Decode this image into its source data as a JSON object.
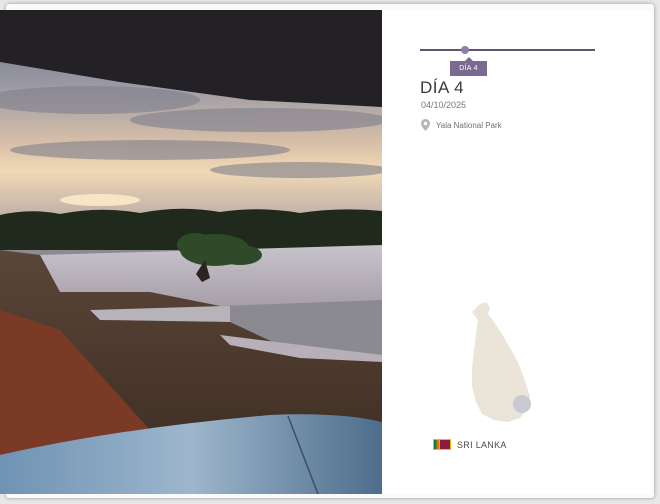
{
  "badge": {
    "label": "DÍA 4"
  },
  "day": {
    "title": "DÍA 4",
    "date": "04/10/2025"
  },
  "location": {
    "name": "Yala National Park",
    "icon": "map-pin-icon"
  },
  "country": {
    "name": "SRI LANKA",
    "icon": "sri-lanka-flag-icon"
  },
  "colors": {
    "accent": "#7a6a92",
    "timeline": "#5e5470",
    "map_fill": "#ebe5d9",
    "map_marker": "#c9c9d2"
  }
}
